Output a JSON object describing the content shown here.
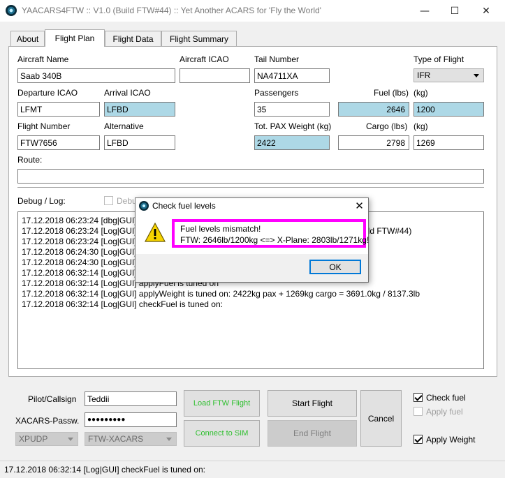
{
  "window": {
    "title": "YAACARS4FTW :: V1.0 (Build FTW#44) :: Yet Another ACARS for 'Fly the World'",
    "minimize": "—",
    "maximize": "☐",
    "close": "✕"
  },
  "tabs": [
    {
      "label": "About"
    },
    {
      "label": "Flight Plan"
    },
    {
      "label": "Flight Data"
    },
    {
      "label": "Flight Summary"
    }
  ],
  "active_tab": "Flight Plan",
  "form": {
    "aircraft_name": {
      "label": "Aircraft Name",
      "value": "Saab 340B"
    },
    "aircraft_icao": {
      "label": "Aircraft ICAO",
      "value": ""
    },
    "tail_number": {
      "label": "Tail Number",
      "value": "NA4711XA"
    },
    "type_of_flight": {
      "label": "Type of Flight",
      "value": "IFR"
    },
    "departure_icao": {
      "label": "Departure ICAO",
      "value": "LFMT"
    },
    "arrival_icao": {
      "label": "Arrival ICAO",
      "value": "LFBD"
    },
    "passengers": {
      "label": "Passengers",
      "value": "35"
    },
    "fuel_lbs": {
      "label": "Fuel (lbs)",
      "value": "2646"
    },
    "fuel_kg": {
      "label": "(kg)",
      "value": "1200"
    },
    "flight_number": {
      "label": "Flight Number",
      "value": "FTW7656"
    },
    "alternative": {
      "label": "Alternative",
      "value": "LFBD"
    },
    "tot_pax_weight": {
      "label": "Tot. PAX Weight (kg)",
      "value": "2422"
    },
    "cargo_lbs": {
      "label": "Cargo (lbs)",
      "value": "2798"
    },
    "cargo_kg": {
      "label": "(kg)",
      "value": "1269"
    },
    "route": {
      "label": "Route:",
      "value": ""
    }
  },
  "debug": {
    "label": "Debug / Log:",
    "checkbox_label": "Debu"
  },
  "log_lines": [
    "17.12.2018 06:23:24 [dbg|GUI]",
    "17.12.2018 06:23:24 [Log|GUI]",
    "17.12.2018 06:23:24 [Log|GUI]",
    "17.12.2018 06:24:30 [Log|GUI]",
    "17.12.2018 06:24:30 [Log|GUI]",
    "17.12.2018 06:32:14 [Log|GUI]",
    "17.12.2018 06:32:14 [Log|GUI] applyFuel is tuned on",
    "17.12.2018 06:32:14 [Log|GUI] applyWeight is tuned on: 2422kg pax + 1269kg cargo = 3691.0kg / 8137.3lb",
    "17.12.2018 06:32:14 [Log|GUI] checkFuel is tuned on:"
  ],
  "log_partial_right": "ild FTW#44)",
  "bottom": {
    "pilot_label": "Pilot/Callsign",
    "pilot_value": "Teddii",
    "password_label": "XACARS-Passw.",
    "password_value": "●●●●●●●●●",
    "combo_protocol": "XPUDP",
    "combo_server": "FTW-XACARS",
    "load_ftw_flight": "Load FTW Flight",
    "connect_to_sim": "Connect to SIM",
    "start_flight": "Start Flight",
    "end_flight": "End Flight",
    "cancel": "Cancel",
    "check_fuel": "Check fuel",
    "apply_fuel": "Apply fuel",
    "apply_weight": "Apply Weight"
  },
  "status": "17.12.2018 06:32:14 [Log|GUI] checkFuel is tuned on:",
  "dialog": {
    "title": "Check fuel levels",
    "close": "✕",
    "message_line1": "Fuel levels mismatch!",
    "message_line2": "FTW: 2646lb/1200kg <=> X-Plane: 2803lb/1271kg!",
    "ok": "OK",
    "highlight_color": "#ff00ff"
  }
}
